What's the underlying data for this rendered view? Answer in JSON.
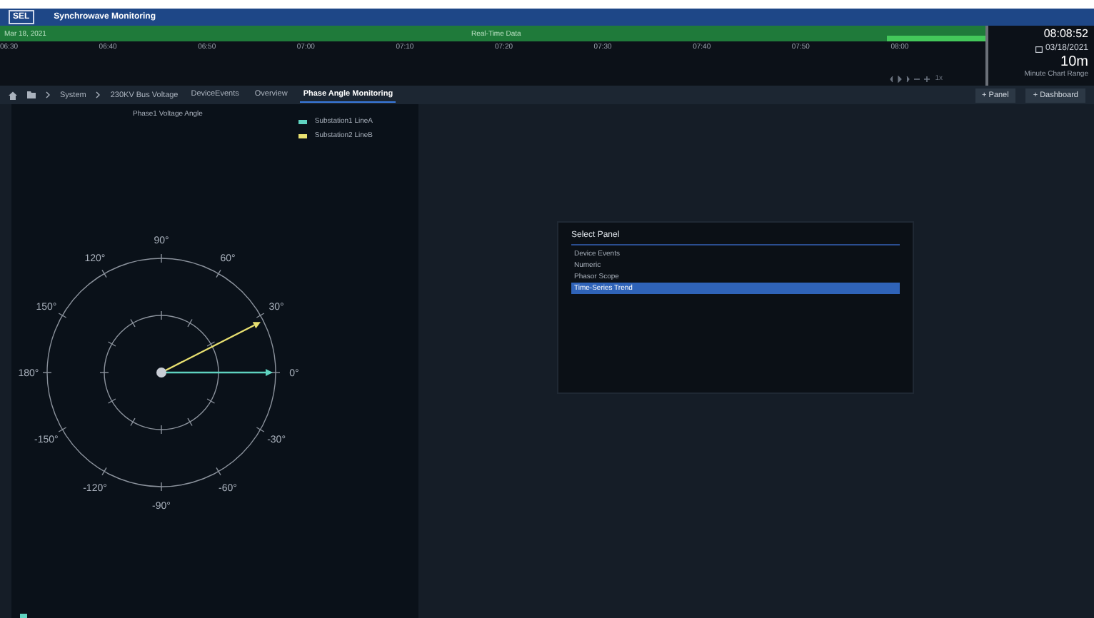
{
  "app": {
    "logo": "SEL",
    "title": "Synchrowave Monitoring"
  },
  "timeline": {
    "date": "Mar 18, 2021",
    "mode": "Real-Time Data",
    "ticks": [
      "06:30",
      "06:40",
      "06:50",
      "07:00",
      "07:10",
      "07:20",
      "07:30",
      "07:40",
      "07:50",
      "08:00"
    ],
    "speed": "1x",
    "level": 0.1
  },
  "clock": {
    "time": "08:08:52",
    "date": "03/18/2021",
    "range": "10m",
    "range_label": "Minute Chart Range"
  },
  "breadcrumb": [
    "System",
    "230KV Bus Voltage"
  ],
  "tabs": [
    {
      "label": "DeviceEvents",
      "selected": false
    },
    {
      "label": "Overview",
      "selected": false
    },
    {
      "label": "Phase Angle Monitoring",
      "selected": true
    }
  ],
  "actions": [
    "+ Panel",
    "+ Dashboard"
  ],
  "phasor_panel": {
    "title": "Phase1 Voltage Angle",
    "legend": [
      {
        "name": "Substation1 LineA",
        "color": "#5fd3c0"
      },
      {
        "name": "Substation2 LineB",
        "color": "#e8e070"
      }
    ],
    "angle_labels": [
      "0°",
      "30°",
      "60°",
      "90°",
      "120°",
      "150°",
      "180°",
      "-150°",
      "-120°",
      "-90°",
      "-60°",
      "-30°"
    ]
  },
  "select_panel": {
    "title": "Select Panel",
    "items": [
      {
        "label": "Device Events",
        "selected": false
      },
      {
        "label": "Numeric",
        "selected": false
      },
      {
        "label": "Phasor Scope",
        "selected": false
      },
      {
        "label": "Time-Series Trend",
        "selected": true
      }
    ]
  }
}
